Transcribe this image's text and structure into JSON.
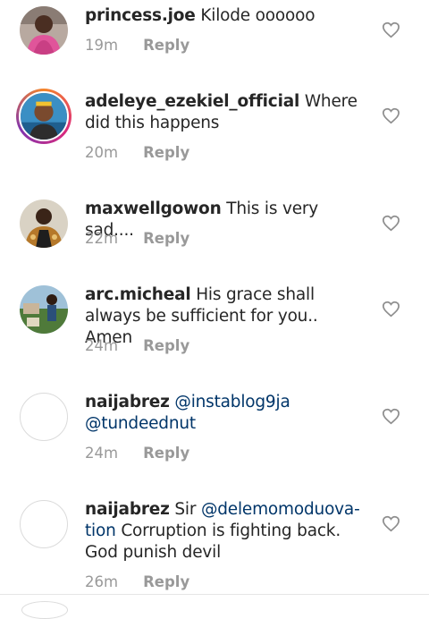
{
  "comments": [
    {
      "username": "princess.joe",
      "text": " Kilode oooooo",
      "time": "19m",
      "reply": "Reply",
      "avatar": "photo-woman-pink"
    },
    {
      "username": "adeleye_ezekiel_official",
      "text": " Where did this happens",
      "time": "20m",
      "reply": "Reply",
      "avatar": "photo-child-story-ring"
    },
    {
      "username": "maxwellgowon",
      "text": " This is very sad....",
      "time": "22m",
      "reply": "Reply",
      "avatar": "photo-man-traditional"
    },
    {
      "username": "arc.micheal",
      "text": " His grace shall always be sufficient for you.. Amen",
      "time": "24m",
      "reply": "Reply",
      "avatar": "photo-outdoor-people"
    },
    {
      "username": "naijabrez",
      "text_before": " ",
      "mention1": "@instablog9ja",
      "text_mid": " ",
      "mention2": "@tundeednut",
      "time": "24m",
      "reply": "Reply",
      "avatar": "empty"
    },
    {
      "username": "naijabrez",
      "text_before": " Sir ",
      "mention1": "@delemomoduova-tion",
      "text_after": "  Corruption is fighting back. God punish devil",
      "time": "26m",
      "reply": "Reply",
      "avatar": "empty"
    }
  ],
  "icons": {
    "like": "heart-outline-icon"
  },
  "colors": {
    "text": "#262626",
    "meta": "#999999",
    "mention": "#003569"
  }
}
